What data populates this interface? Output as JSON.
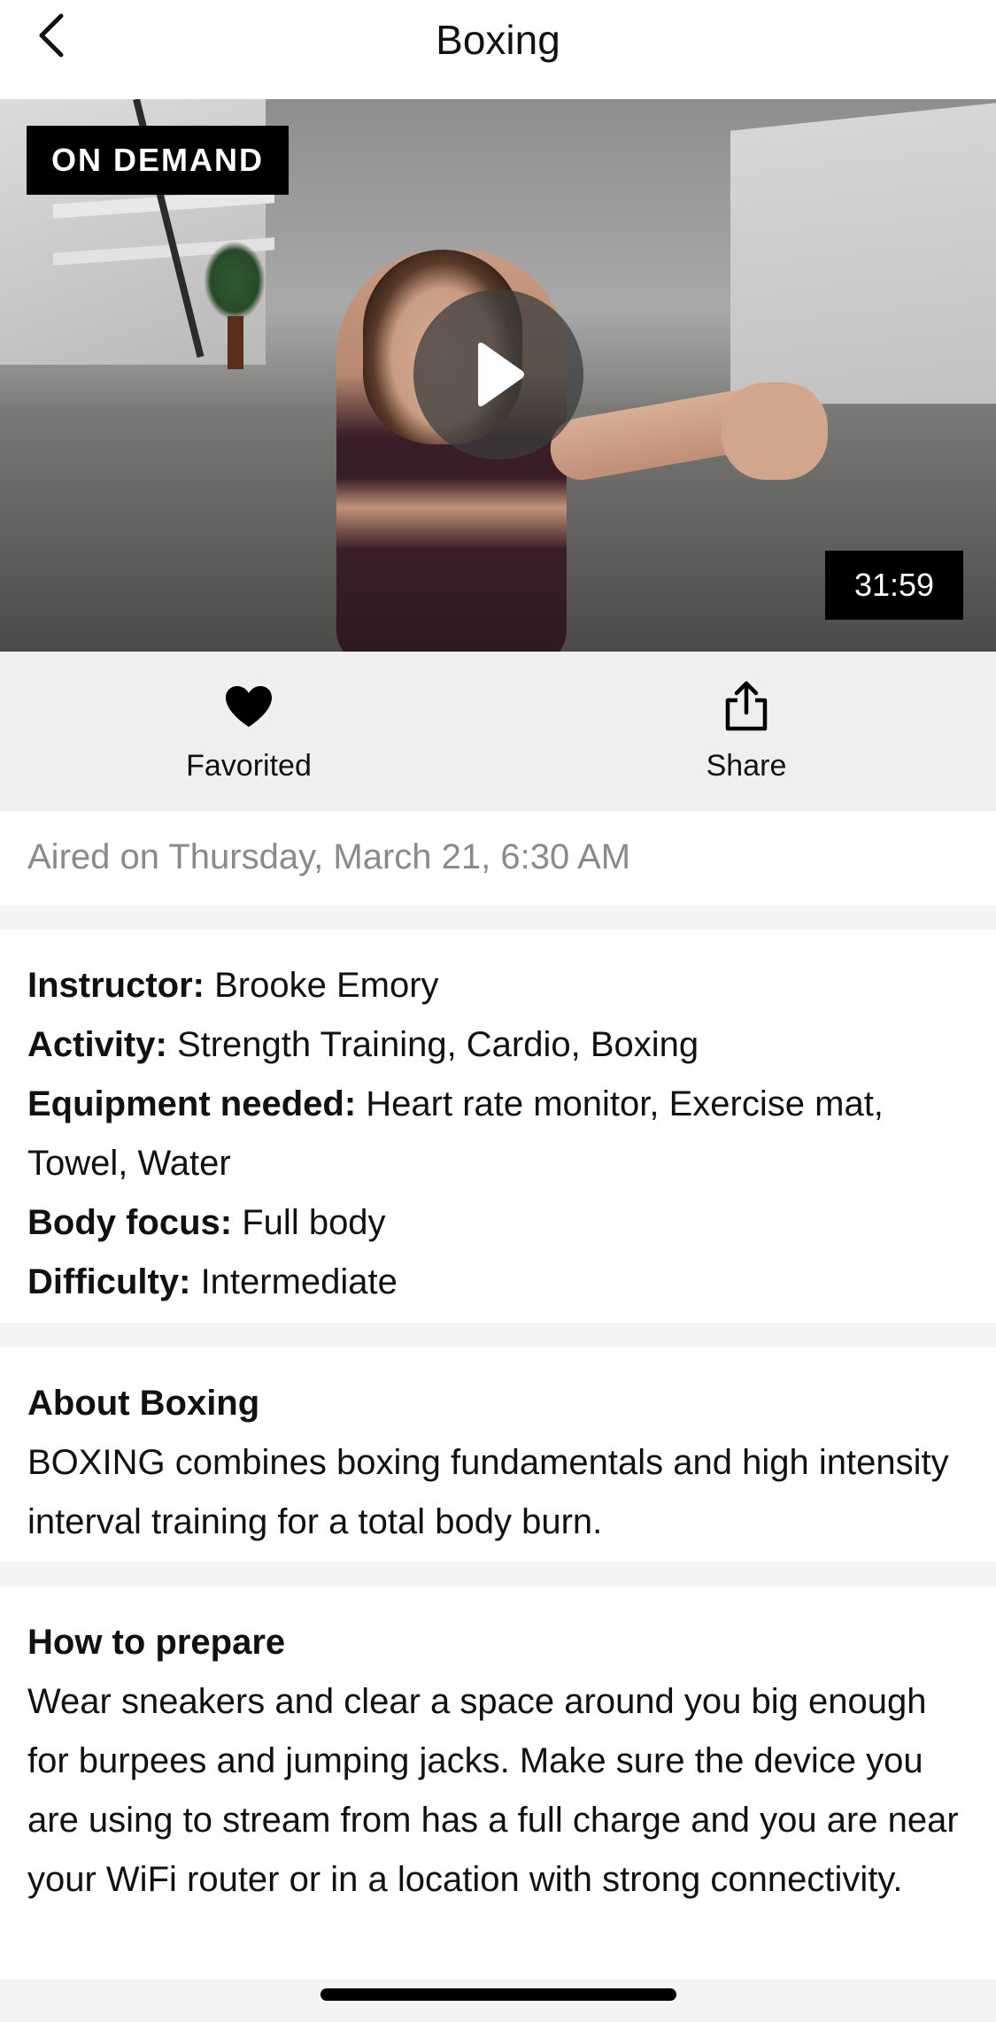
{
  "header": {
    "title": "Boxing",
    "back_icon": "chevron-left-icon"
  },
  "video": {
    "badge": "ON DEMAND",
    "duration": "31:59",
    "play_icon": "play-icon"
  },
  "actions": {
    "favorite": {
      "label": "Favorited",
      "icon": "heart-icon"
    },
    "share": {
      "label": "Share",
      "icon": "share-icon"
    }
  },
  "aired": "Aired on Thursday, March 21, 6:30 AM",
  "details": {
    "instructor": {
      "key": "Instructor:",
      "value": "Brooke Emory"
    },
    "activity": {
      "key": "Activity:",
      "value": "Strength Training, Cardio, Boxing"
    },
    "equipment": {
      "key": "Equipment needed:",
      "value": "Heart rate monitor, Exercise mat, Towel, Water"
    },
    "body_focus": {
      "key": "Body focus:",
      "value": "Full body"
    },
    "difficulty": {
      "key": "Difficulty:",
      "value": "Intermediate"
    }
  },
  "about": {
    "heading": "About Boxing",
    "text": "BOXING combines boxing fundamentals and high intensity interval training for a total body burn."
  },
  "prepare": {
    "heading": "How to prepare",
    "text": "Wear sneakers and clear a space around you big enough for burpees and jumping jacks. Make sure the device you are using to stream from has a full charge and you are near your WiFi router or in a location with strong connectivity."
  },
  "colors": {
    "background": "#f4f4f4",
    "card": "#ffffff",
    "action_bar": "#efefef",
    "badge_bg": "#000000",
    "muted_text": "#8a8a8a"
  }
}
